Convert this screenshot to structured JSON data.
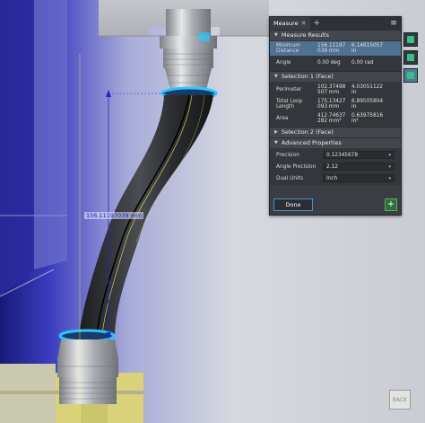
{
  "panel": {
    "tab_label": "Measure",
    "tab_close": "✕",
    "add_tab": "+",
    "menu_icon": "≡",
    "measure_results": {
      "header": "Measure Results",
      "rows": [
        {
          "label": "Minimum Distance",
          "v1": "156.11197 039 mm",
          "v2": "6.14615057 in"
        },
        {
          "label": "Angle",
          "v1": "0.00 deg",
          "v2": "0.00 rad"
        }
      ]
    },
    "selection1": {
      "header": "Selection 1 (Face)",
      "rows": [
        {
          "label": "Perimeter",
          "v1": "102.37498 507 mm",
          "v2": "4.03051122 in"
        },
        {
          "label": "Total Loop Length",
          "v1": "175.13427 093 mm",
          "v2": "6.89505804 in"
        },
        {
          "label": "Area",
          "v1": "412.74637 282 mm²",
          "v2": "0.63975816 in²"
        }
      ]
    },
    "selection2": {
      "header": "Selection 2 (Face)"
    },
    "advanced": {
      "header": "Advanced Properties",
      "precision_label": "Precision",
      "precision_value": "0.12345678",
      "angle_precision_label": "Angle Precision",
      "angle_precision_value": "2.12",
      "dual_units_label": "Dual Units",
      "dual_units_value": "Inch"
    },
    "done_label": "Done",
    "plus_label": "+"
  },
  "dimension_label": "156.11197039 mm",
  "viewcube_label": "BACK",
  "colors": {
    "accent_blue": "#2a7fd6",
    "selection_cyan": "#28c8ff",
    "dimension_blue": "#1a28c8",
    "hose_black": "#26282b",
    "background_dark_blue": "#16188a",
    "side_tool_green": "#3bbd8a"
  },
  "icons": {
    "caret_open": "▼",
    "caret_closed": "▶",
    "dropdown": "▾"
  }
}
